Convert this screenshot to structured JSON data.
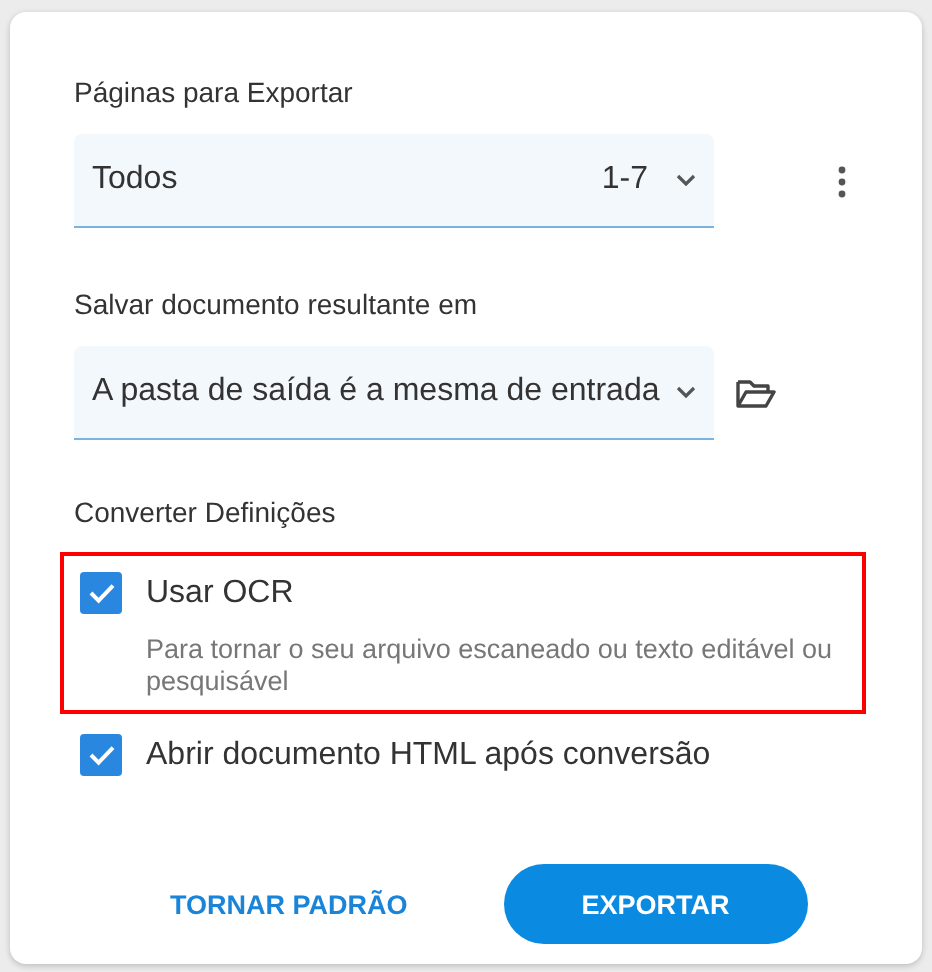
{
  "pages_section": {
    "label": "Páginas para Exportar",
    "select": {
      "value": "Todos",
      "range": "1-7"
    }
  },
  "output_section": {
    "label": "Salvar documento resultante em",
    "select": {
      "value": "A pasta de saída é a mesma de entrada"
    }
  },
  "settings_section": {
    "label": "Converter Definições",
    "options": [
      {
        "label": "Usar OCR",
        "description": "Para tornar o seu arquivo escaneado ou texto editável ou pesquisável",
        "checked": true,
        "highlighted": true
      },
      {
        "label": "Abrir documento HTML após conversão",
        "checked": true,
        "highlighted": false
      }
    ]
  },
  "buttons": [
    {
      "label": "TORNAR PADRÃO",
      "kind": "text"
    },
    {
      "label": "EXPORTAR",
      "kind": "primary"
    }
  ]
}
